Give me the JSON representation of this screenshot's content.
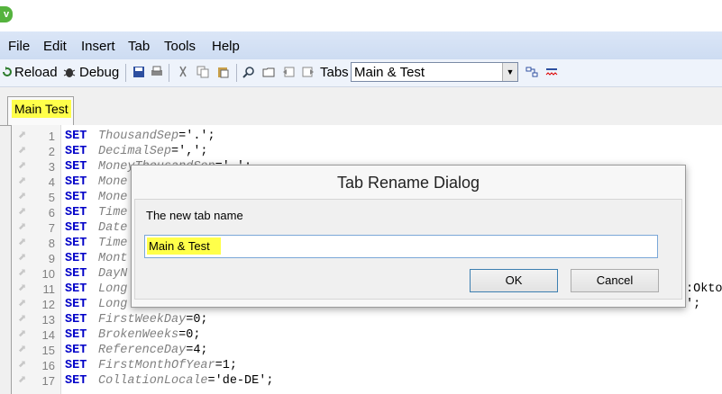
{
  "menu": [
    "File",
    "Edit",
    "Insert",
    "Tab",
    "Tools",
    "Help"
  ],
  "toolbar": {
    "reload_label": "Reload",
    "debug_label": "Debug",
    "tabs_label": "Tabs",
    "tabs_value": "Main & Test"
  },
  "active_tab": "Main Test",
  "code_lines": [
    {
      "n": "1",
      "kw": "SET",
      "var": "ThousandSep",
      "rest": "='.';"
    },
    {
      "n": "2",
      "kw": "SET",
      "var": "DecimalSep",
      "rest": "=',';"
    },
    {
      "n": "3",
      "kw": "SET",
      "var": "MoneyThousandSep",
      "rest": "='.';"
    },
    {
      "n": "4",
      "kw": "SET",
      "var": "Mone",
      "rest": ""
    },
    {
      "n": "5",
      "kw": "SET",
      "var": "Mone",
      "rest": ""
    },
    {
      "n": "6",
      "kw": "SET",
      "var": "Time",
      "rest": ""
    },
    {
      "n": "7",
      "kw": "SET",
      "var": "Date",
      "rest": ""
    },
    {
      "n": "8",
      "kw": "SET",
      "var": "Time",
      "rest": ""
    },
    {
      "n": "9",
      "kw": "SET",
      "var": "Mont",
      "rest": ""
    },
    {
      "n": "10",
      "kw": "SET",
      "var": "DayN",
      "rest": ""
    },
    {
      "n": "11",
      "kw": "SET",
      "var": "Long",
      "rest": ""
    },
    {
      "n": "12",
      "kw": "SET",
      "var": "Long",
      "rest": ""
    },
    {
      "n": "13",
      "kw": "SET",
      "var": "FirstWeekDay",
      "rest": "=0;"
    },
    {
      "n": "14",
      "kw": "SET",
      "var": "BrokenWeeks",
      "rest": "=0;"
    },
    {
      "n": "15",
      "kw": "SET",
      "var": "ReferenceDay",
      "rest": "=4;"
    },
    {
      "n": "16",
      "kw": "SET",
      "var": "FirstMonthOfYear",
      "rest": "=1;"
    },
    {
      "n": "17",
      "kw": "SET",
      "var": "CollationLocale",
      "rest": "='de-DE';"
    }
  ],
  "line11_tail": ":Oktol",
  "line12_tail": "';",
  "dialog": {
    "title": "Tab Rename Dialog",
    "label": "The new tab name",
    "value": "Main & Test",
    "ok": "OK",
    "cancel": "Cancel"
  }
}
